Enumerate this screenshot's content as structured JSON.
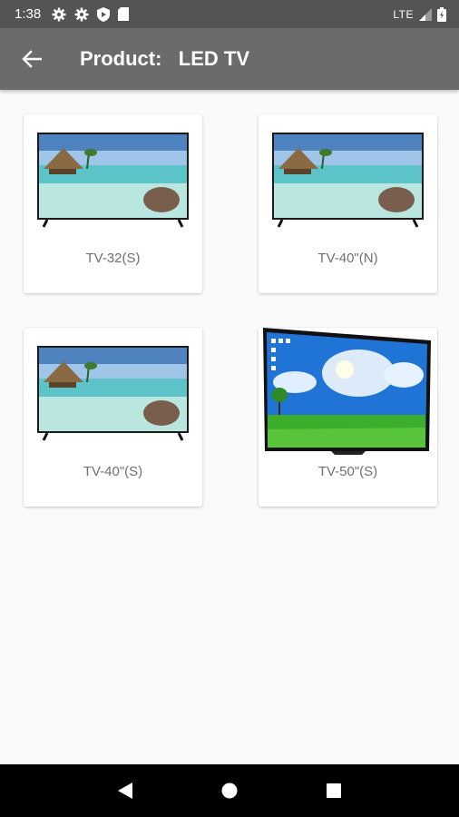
{
  "status_bar": {
    "time": "1:38",
    "icons": [
      "gear-icon",
      "gear-icon",
      "shield-play-icon",
      "sd-card-icon"
    ],
    "network": "LTE",
    "right_icons": [
      "signal-icon",
      "battery-icon"
    ]
  },
  "app_bar": {
    "back_icon": "arrow-left-icon",
    "title": "Product:   LED TV"
  },
  "products": [
    {
      "label": "TV-32(S)",
      "image": "tv-beach"
    },
    {
      "label": "TV-40\"(N)",
      "image": "tv-beach"
    },
    {
      "label": "TV-40\"(S)",
      "image": "tv-beach"
    },
    {
      "label": "TV-50\"(S)",
      "image": "tv-grass-sky"
    }
  ],
  "nav_bar": {
    "buttons": [
      "back-triangle-icon",
      "home-circle-icon",
      "recents-square-icon"
    ]
  },
  "colors": {
    "status_bar": "#545454",
    "app_bar": "#6b6b6b",
    "background": "#fafafa",
    "card": "#ffffff",
    "label_text": "#6f6f6f"
  }
}
